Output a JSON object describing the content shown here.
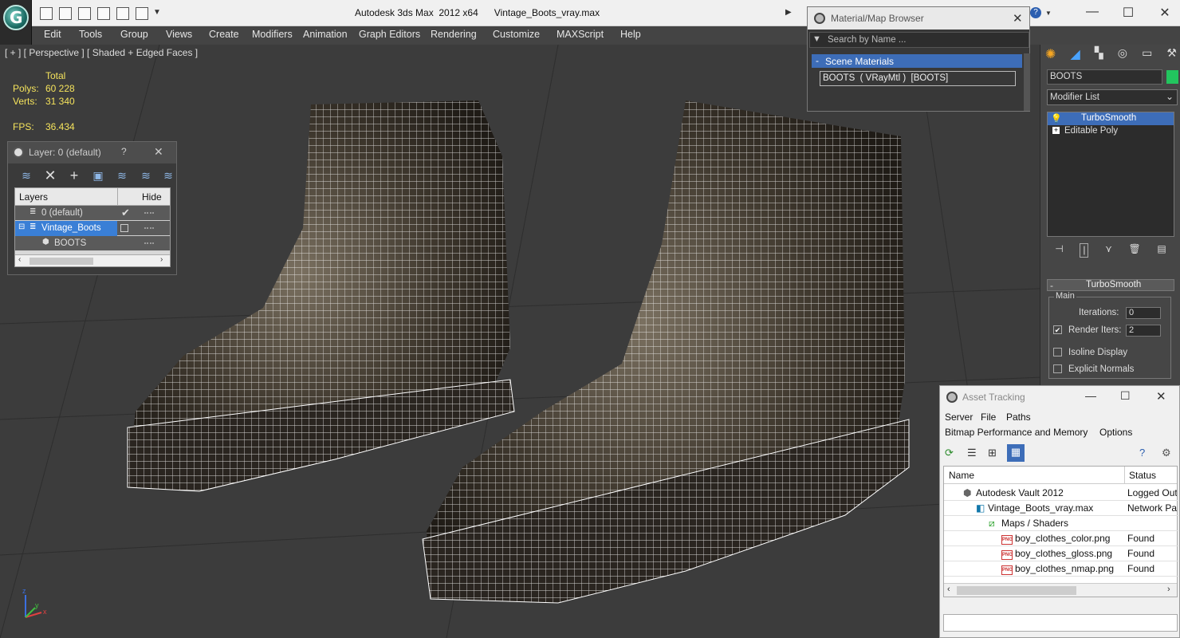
{
  "window": {
    "app_title": "Autodesk 3ds Max  2012 x64",
    "file_name": "Vintage_Boots_vray.max"
  },
  "menu": [
    "Edit",
    "Tools",
    "Group",
    "Views",
    "Create",
    "Modifiers",
    "Animation",
    "Graph Editors",
    "Rendering",
    "Customize",
    "MAXScript",
    "Help"
  ],
  "viewport": {
    "label": "[ + ] [ Perspective ] [ Shaded + Edged Faces ]",
    "stats": {
      "total_label": "Total",
      "polys_label": "Polys:",
      "polys": "60 228",
      "verts_label": "Verts:",
      "verts": "31 340",
      "fps_label": "FPS:",
      "fps": "36.434"
    },
    "axis": {
      "z": "z",
      "x": "x",
      "y": "y"
    }
  },
  "layer_panel": {
    "title": "Layer: 0 (default)",
    "help": "?",
    "col_layers": "Layers",
    "col_hide": "Hide",
    "rows": [
      {
        "name": "0 (default)"
      },
      {
        "name": "Vintage_Boots"
      },
      {
        "name": "BOOTS"
      }
    ]
  },
  "material_browser": {
    "title": "Material/Map Browser",
    "search_placeholder": "Search by Name ...",
    "section": "Scene Materials",
    "section_toggle": "-",
    "item": "BOOTS  ( VRayMtl )  [BOOTS]"
  },
  "command_panel": {
    "object_name": "BOOTS",
    "modifier_list": "Modifier List",
    "stack": [
      "TurboSmooth",
      "Editable Poly"
    ],
    "rollout_title": "TurboSmooth",
    "group_main": "Main",
    "iterations_label": "Iterations:",
    "iterations": "0",
    "render_iters_label": "Render Iters:",
    "render_iters": "2",
    "isoline": "Isoline Display",
    "explicit": "Explicit Normals",
    "accent": "#22c55e"
  },
  "asset_tracking": {
    "title": "Asset Tracking",
    "menu1": [
      "Server",
      "File",
      "Paths"
    ],
    "menu2": [
      "Bitmap Performance and Memory",
      "Options"
    ],
    "col_name": "Name",
    "col_status": "Status",
    "rows": [
      {
        "name": "Autodesk Vault 2012",
        "status": "Logged Out"
      },
      {
        "name": "Vintage_Boots_vray.max",
        "status": "Network Path"
      },
      {
        "name": "Maps / Shaders",
        "status": ""
      },
      {
        "name": "boy_clothes_color.png",
        "status": "Found"
      },
      {
        "name": "boy_clothes_gloss.png",
        "status": "Found"
      },
      {
        "name": "boy_clothes_nmap.png",
        "status": "Found"
      }
    ],
    "png_badge": "PNG"
  }
}
